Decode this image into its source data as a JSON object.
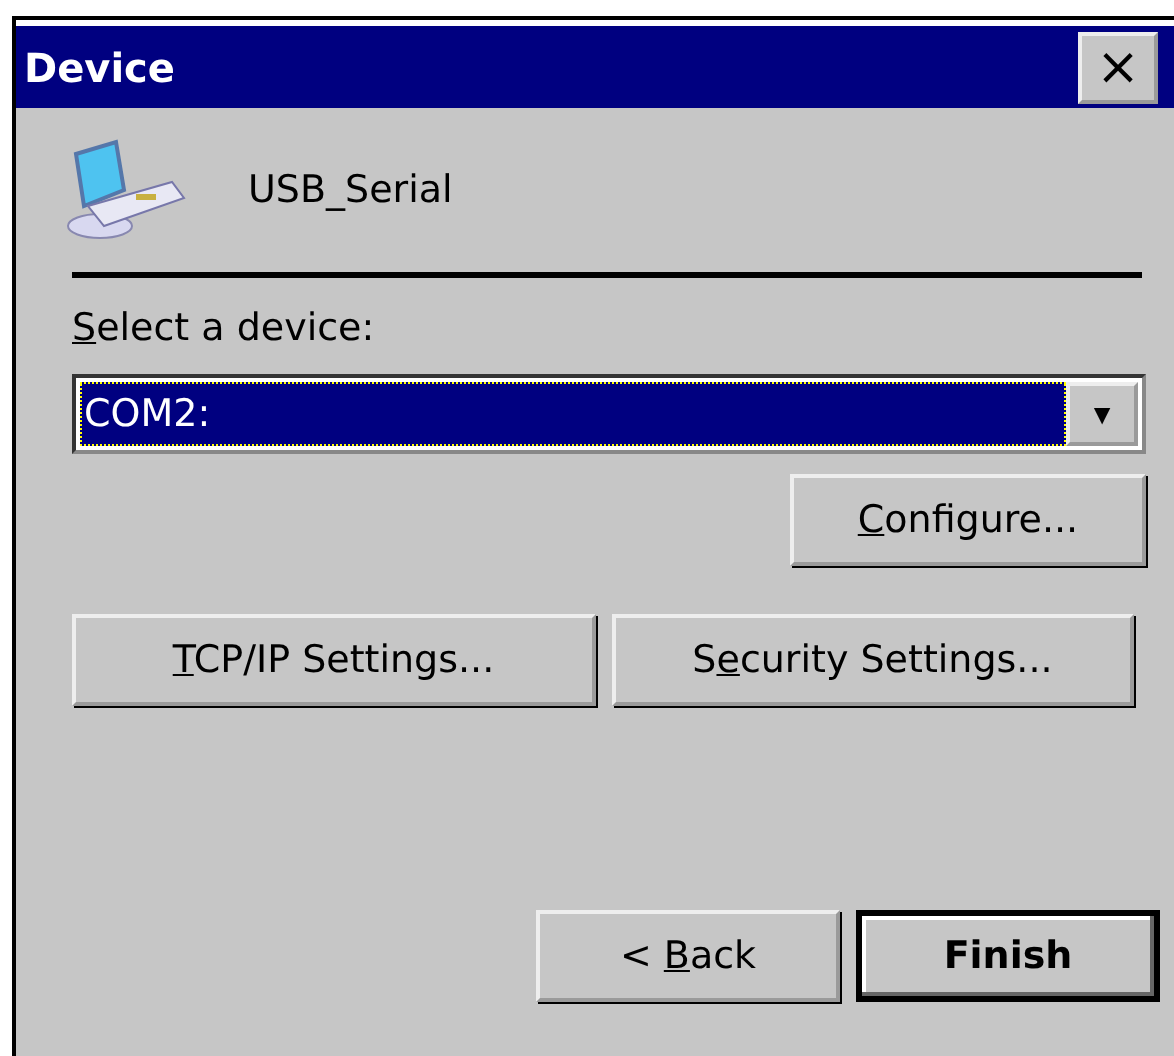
{
  "window": {
    "title": "Device",
    "close": "×"
  },
  "device": {
    "name": "USB_Serial"
  },
  "select_label": {
    "parts": {
      "key": "S",
      "after": "elect a device:"
    }
  },
  "device_select": {
    "value": "COM2:",
    "selected": true,
    "arrow": "▼"
  },
  "buttons": [
    {
      "kind": "configure",
      "parts": {
        "key": "C",
        "after": "onfigure..."
      },
      "default": false
    },
    {
      "kind": "settings",
      "parts": {
        "key": "T",
        "after": "CP/IP Settings..."
      },
      "default": false
    },
    {
      "kind": "settings",
      "parts": {
        "before": "S",
        "key": "e",
        "after": "curity Settings..."
      },
      "default": false
    },
    {
      "kind": "nav",
      "parts": {
        "before": "< ",
        "key": "B",
        "after": "ack"
      },
      "default": false
    },
    {
      "kind": "nav",
      "parts": {
        "before": "Finish"
      },
      "default": true
    }
  ]
}
